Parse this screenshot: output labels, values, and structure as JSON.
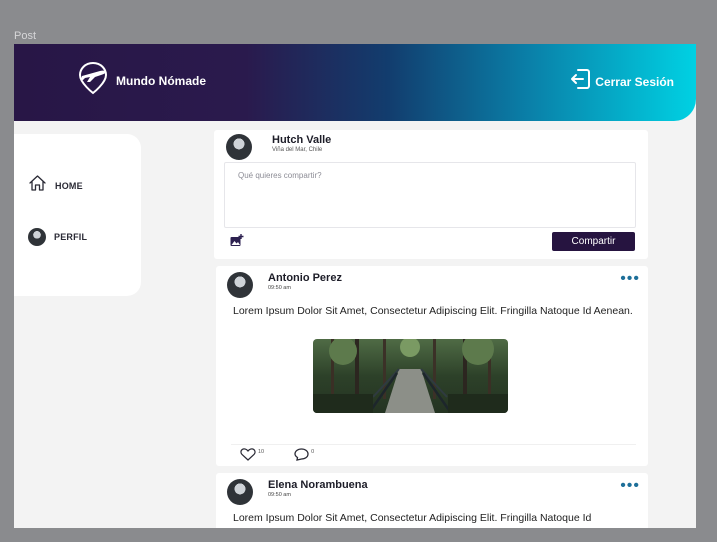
{
  "frame": {
    "label": "Post"
  },
  "header": {
    "brand": "Mundo Nómade",
    "logout_label": "Cerrar Sesión",
    "icons": {
      "logo": "plane-pin-icon",
      "logout": "logout-icon"
    }
  },
  "sidebar": {
    "items": [
      {
        "label": "HOME",
        "icon": "home-icon"
      },
      {
        "label": "PERFIL",
        "icon": "avatar-icon"
      }
    ]
  },
  "composer": {
    "user_name": "Hutch Valle",
    "user_location": "Viña del Mar, Chile",
    "placeholder": "Qué quieres compartir?",
    "share_label": "Compartir",
    "icons": {
      "photo": "add-photo-icon"
    }
  },
  "posts": [
    {
      "author": "Antonio Perez",
      "time": "09:50 am",
      "text": "Lorem Ipsum Dolor Sit Amet, Consectetur Adipiscing Elit. Fringilla Natoque Id Aenean.",
      "likes": "10",
      "comments": "0",
      "has_image": true
    },
    {
      "author": "Elena Norambuena",
      "time": "09:50 am",
      "text": "Lorem Ipsum Dolor Sit Amet, Consectetur Adipiscing Elit. Fringilla Natoque Id"
    }
  ],
  "colors": {
    "header_start": "#281646",
    "header_end": "#00d1e3",
    "button": "#261440",
    "dots": "#1d6f99"
  }
}
